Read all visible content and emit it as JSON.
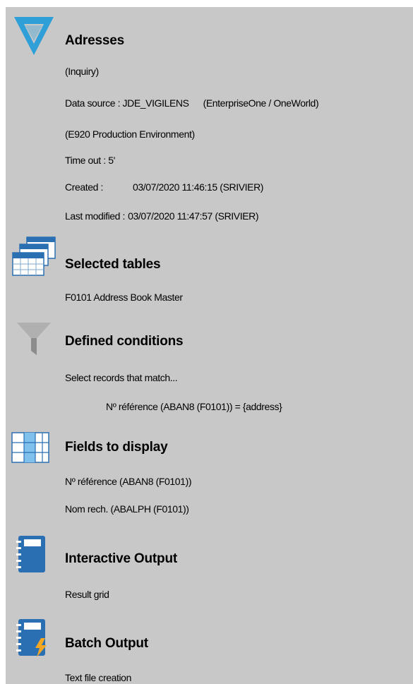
{
  "header": {
    "title": "Adresses",
    "mode": "(Inquiry)",
    "data_source_label": "Data source : JDE_VIGILENS",
    "data_source_type": "(EnterpriseOne / OneWorld)",
    "environment": "(E920 Production Environment)",
    "timeout": "Time out : 5'",
    "created_label": "Created :",
    "created_value": "03/07/2020 11:46:15 (SRIVIER)",
    "modified_label": "Last modified :",
    "modified_value": "03/07/2020 11:47:57 (SRIVIER)"
  },
  "tables": {
    "title": "Selected tables",
    "items": [
      "F0101  Address Book Master"
    ]
  },
  "conditions": {
    "title": "Defined conditions",
    "intro": "Select records that match...",
    "items": [
      "Nº référence (ABAN8 (F0101)) = {address}"
    ]
  },
  "fields": {
    "title": "Fields to display",
    "items": [
      "Nº référence (ABAN8 (F0101))",
      "Nom rech. (ABALPH (F0101))"
    ]
  },
  "interactive": {
    "title": "Interactive Output",
    "detail": "Result grid"
  },
  "batch": {
    "title": "Batch Output",
    "detail": "Text file creation"
  },
  "colors": {
    "panel_background": "#c8c8c8",
    "logo_blue": "#2f9fd8",
    "icon_blue": "#2b6fb3",
    "lightning_orange": "#f5a623"
  },
  "icons": [
    "vigilens-logo-icon",
    "tables-icon",
    "funnel-icon",
    "columns-icon",
    "notebook-icon",
    "notebook-lightning-icon"
  ]
}
